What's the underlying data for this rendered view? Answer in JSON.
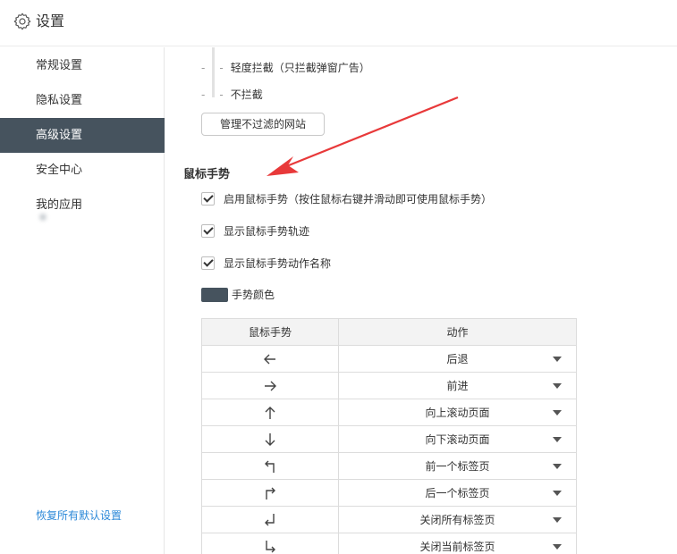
{
  "header": {
    "title": "设置",
    "icon": "gear-icon"
  },
  "sidebar": {
    "items": [
      {
        "label": "常规设置",
        "active": false
      },
      {
        "label": "隐私设置",
        "active": false
      },
      {
        "label": "高级设置",
        "active": true
      },
      {
        "label": "安全中心",
        "active": false
      },
      {
        "label": "我的应用",
        "active": false
      }
    ],
    "restore_label": "恢复所有默认设置"
  },
  "filter": {
    "light_label": "轻度拦截（只拦截弹窗广告）",
    "none_label": "不拦截",
    "dash": "-",
    "manage_button": "管理不过滤的网站"
  },
  "mouse_gesture": {
    "title": "鼠标手势",
    "options": [
      {
        "label": "启用鼠标手势（按住鼠标右键并滑动即可使用鼠标手势）",
        "checked": true
      },
      {
        "label": "显示鼠标手势轨迹",
        "checked": true
      },
      {
        "label": "显示鼠标手势动作名称",
        "checked": true
      }
    ],
    "color_label": "手势颜色",
    "color": "#46535e"
  },
  "gesture_table": {
    "headers": [
      "鼠标手势",
      "动作"
    ],
    "rows": [
      {
        "gesture": "arrow-left-icon",
        "action": "后退"
      },
      {
        "gesture": "arrow-right-icon",
        "action": "前进"
      },
      {
        "gesture": "arrow-up-icon",
        "action": "向上滚动页面"
      },
      {
        "gesture": "arrow-down-icon",
        "action": "向下滚动页面"
      },
      {
        "gesture": "up-left-icon",
        "action": "前一个标签页"
      },
      {
        "gesture": "up-right-icon",
        "action": "后一个标签页"
      },
      {
        "gesture": "down-left-icon",
        "action": "关闭所有标签页"
      },
      {
        "gesture": "down-right-icon",
        "action": "关闭当前标签页"
      }
    ]
  },
  "colors": {
    "active_nav": "#46535e",
    "link": "#2b88d8",
    "annotation_arrow": "#e8393a"
  }
}
